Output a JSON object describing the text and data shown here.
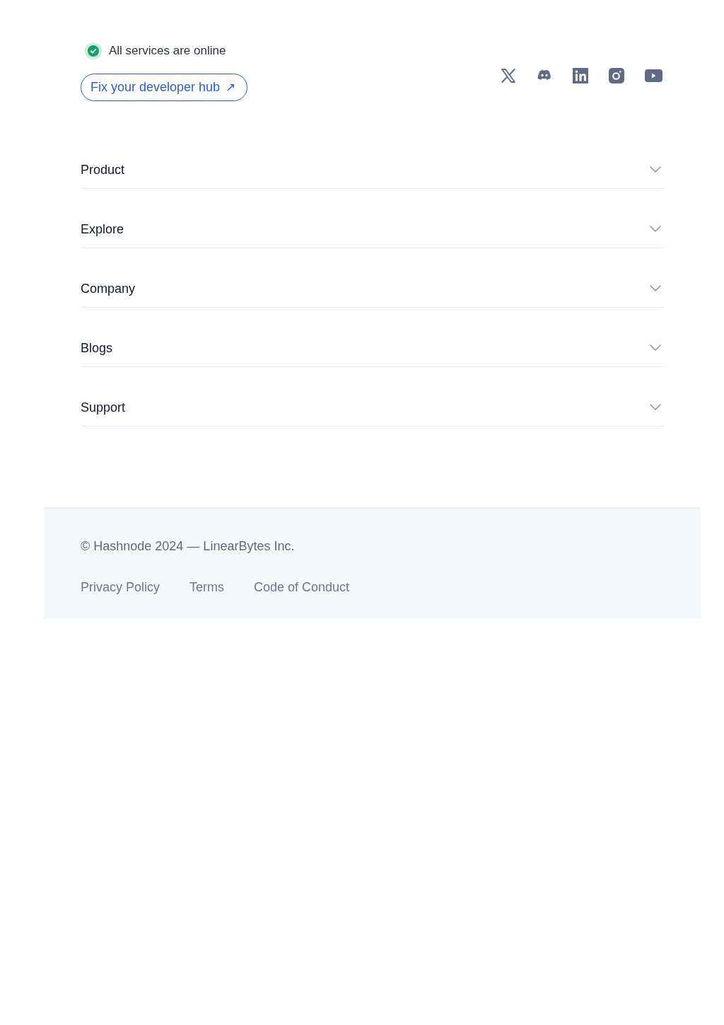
{
  "status": {
    "text": "All services are online",
    "online": true
  },
  "cta_button": {
    "label": "Fix your developer hub",
    "arrow": "↗"
  },
  "social_links": [
    {
      "kind": "x"
    },
    {
      "kind": "discord"
    },
    {
      "kind": "linkedin"
    },
    {
      "kind": "instagram"
    },
    {
      "kind": "youtube"
    }
  ],
  "sections": [
    {
      "label": "Product",
      "expanded": false
    },
    {
      "label": "Explore",
      "expanded": false
    },
    {
      "label": "Company",
      "expanded": false
    },
    {
      "label": "Blogs",
      "expanded": false
    },
    {
      "label": "Support",
      "expanded": false
    }
  ],
  "footer": {
    "copyright": "© Hashnode 2024 — LinearBytes Inc.",
    "links": [
      "Privacy Policy",
      "Terms",
      "Code of Conduct"
    ]
  }
}
